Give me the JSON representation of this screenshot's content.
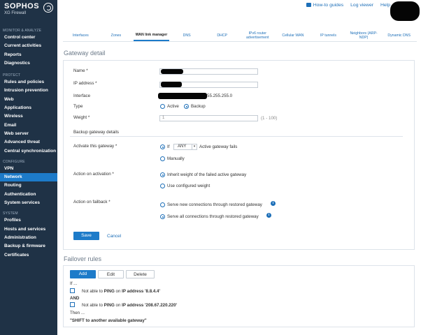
{
  "sidebar": {
    "brand": "SOPHOS",
    "product": "XG Firewall",
    "sections": [
      {
        "title": "MONITOR & ANALYZE",
        "items": [
          "Control center",
          "Current activities",
          "Reports",
          "Diagnostics"
        ]
      },
      {
        "title": "PROTECT",
        "items": [
          "Rules and policies",
          "Intrusion prevention",
          "Web",
          "Applications",
          "Wireless",
          "Email",
          "Web server",
          "Advanced threat",
          "Central synchronization"
        ]
      },
      {
        "title": "CONFIGURE",
        "items": [
          "VPN",
          "Network",
          "Routing",
          "Authentication",
          "System services"
        ]
      },
      {
        "title": "SYSTEM",
        "items": [
          "Profiles",
          "Hosts and services",
          "Administration",
          "Backup & firmware",
          "Certificates"
        ]
      }
    ],
    "active": "Network"
  },
  "topnav": {
    "how_to": "How-to guides",
    "log_viewer": "Log viewer",
    "help": "Help"
  },
  "tabs": [
    "Interfaces",
    "Zones",
    "WAN link manager",
    "DNS",
    "DHCP",
    "IPv6 router advertisement",
    "Cellular WAN",
    "IP tunnels",
    "Neighbors (ARP-NDP)",
    "Dynamic DNS"
  ],
  "active_tab": "WAN link manager",
  "gateway": {
    "title": "Gateway detail",
    "name_label": "Name *",
    "ip_label": "IP address *",
    "interface_label": "Interface",
    "interface_suffix": "55.255.255.0",
    "type_label": "Type",
    "type_active": "Active",
    "type_backup": "Backup",
    "type_selected": "Backup",
    "weight_label": "Weight *",
    "weight_value": "1",
    "weight_hint": "(1 - 100)",
    "backup_title": "Backup gateway details",
    "activate_label": "Activate this gateway *",
    "if_label": "If",
    "any_value": "ANY",
    "active_fails": "Active gateway fails",
    "manually": "Manually",
    "action_activation_label": "Action on activation *",
    "inherit_weight": "Inherit weight of the failed active gateway",
    "use_weight": "Use configured weight",
    "action_failback_label": "Action on failback *",
    "serve_new": "Serve new connections through restored gateway",
    "serve_all": "Serve all connections through restored gateway",
    "save": "Save",
    "cancel": "Cancel"
  },
  "failover": {
    "title": "Failover rules",
    "add": "Add",
    "edit": "Edit",
    "delete": "Delete",
    "if": "If ...",
    "rule1_prefix": "Not able to",
    "rule1_protocol": "PING",
    "rule1_mid": "on",
    "rule1_ip": "IP address '8.8.4.4'",
    "and": "AND",
    "rule2_prefix": "Not able to",
    "rule2_protocol": "PING",
    "rule2_mid": "on",
    "rule2_ip": "IP address '208.67.220.220'",
    "then": "Then ...",
    "shift": "\"SHIFT to another available gateway\""
  }
}
